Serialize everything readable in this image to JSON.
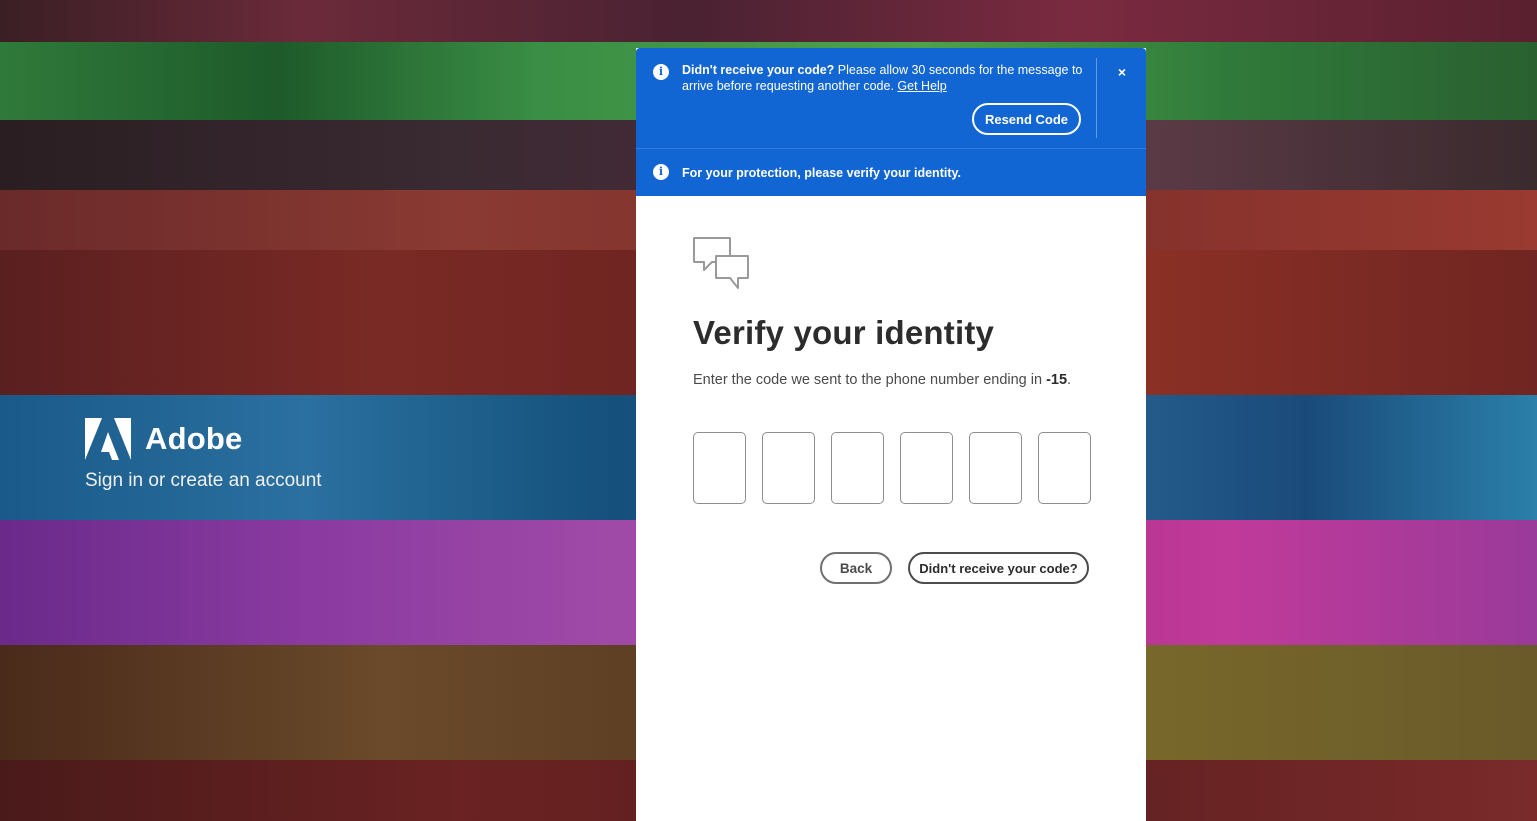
{
  "brand": {
    "name": "Adobe",
    "subtitle": "Sign in or create an account"
  },
  "toast": {
    "icon": "info-icon",
    "bold_text": "Didn't receive your code?",
    "message": " Please allow 30 seconds for the message to arrive before requesting another code. ",
    "link_text": "Get Help",
    "resend_label": "Resend Code",
    "close_label": "×"
  },
  "notice": {
    "icon": "info-icon",
    "text": "For your protection, please verify your identity."
  },
  "main": {
    "icon": "chat-bubbles-icon",
    "title": "Verify your identity",
    "subtitle_prefix": "Enter the code we sent to the phone number ending in ",
    "phone_suffix": "-15",
    "subtitle_end": ".",
    "code_boxes": [
      "",
      "",
      "",
      "",
      "",
      ""
    ],
    "back_label": "Back",
    "no_code_label": "Didn't receive your code?"
  },
  "colors": {
    "accent_blue": "#1266d4",
    "text_dark": "#2c2c2c"
  }
}
